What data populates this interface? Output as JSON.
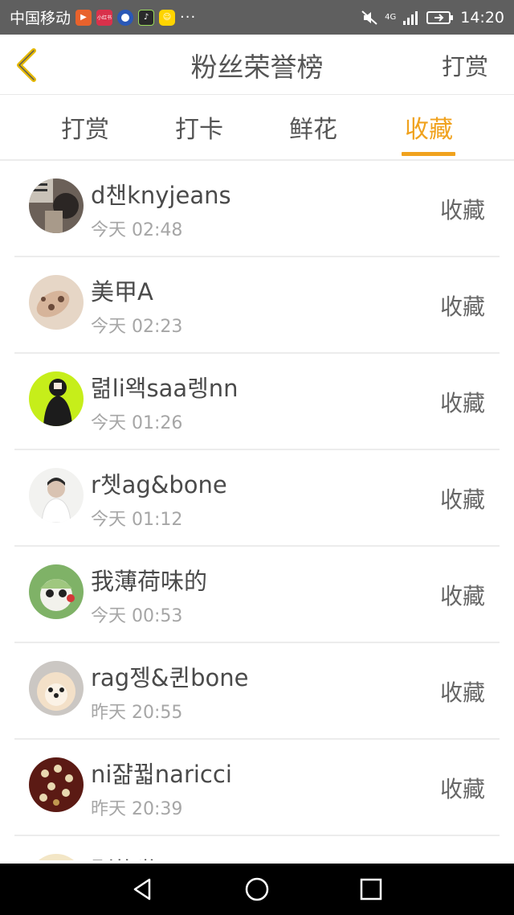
{
  "status_bar": {
    "carrier": "中国移动",
    "app_icon_labels": [
      "",
      "小红书",
      "",
      "",
      ""
    ],
    "more": "···",
    "network": "4G",
    "time": "14:20",
    "icons": [
      "mute-icon",
      "signal-icon",
      "battery-icon"
    ]
  },
  "header": {
    "back_icon": "chevron-left-icon",
    "title": "粉丝荣誉榜",
    "action_label": "打赏"
  },
  "tabs": [
    {
      "label": "打赏",
      "active": false
    },
    {
      "label": "打卡",
      "active": false
    },
    {
      "label": "鲜花",
      "active": false
    },
    {
      "label": "收藏",
      "active": true
    }
  ],
  "colors": {
    "accent": "#f0a21e",
    "text_primary": "#4a4a4a",
    "text_secondary": "#a6a6a6",
    "status_bar": "#5f5f5f",
    "nav_bar": "#000000"
  },
  "list": [
    {
      "name": "d챈knyjeans",
      "time": "今天 02:48",
      "action": "收藏"
    },
    {
      "name": "美甲A",
      "time": "今天 02:23",
      "action": "收藏"
    },
    {
      "name": "렮li왝saa렝nn",
      "time": "今天 01:26",
      "action": "收藏"
    },
    {
      "name": "r쳇ag&bone",
      "time": "今天 01:12",
      "action": "收藏"
    },
    {
      "name": "我薄荷味的",
      "time": "今天 00:53",
      "action": "收藏"
    },
    {
      "name": "rag젱&퀸bone",
      "time": "昨天 20:55",
      "action": "收藏"
    },
    {
      "name": "ni쟒꿟naricci",
      "time": "昨天 20:39",
      "action": "收藏"
    },
    {
      "name": "别炸酱面",
      "time": "",
      "action": ""
    }
  ],
  "nav_bar": {
    "icons": [
      "back-triangle-icon",
      "home-circle-icon",
      "recents-square-icon"
    ]
  }
}
